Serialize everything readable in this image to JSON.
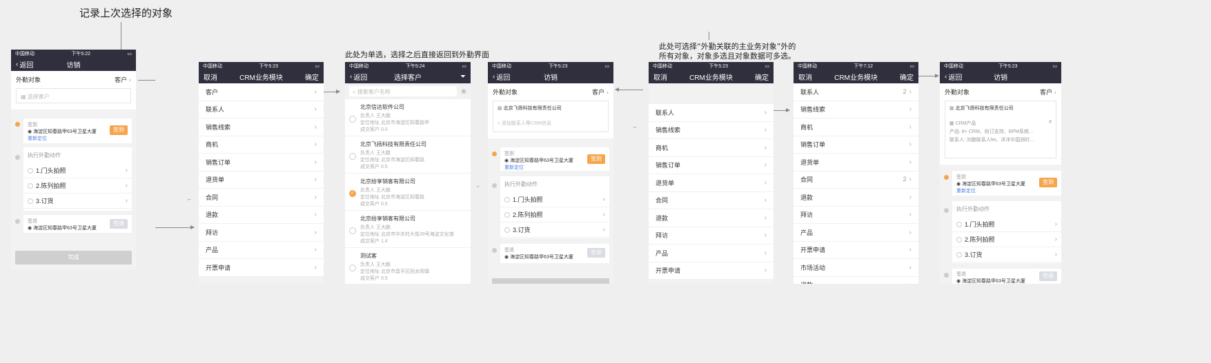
{
  "annotations": {
    "top_note": "记录上次选择的对象",
    "single_select": "此处为单选，选择之后直接返回到外勤界面",
    "multi_note_line1": "此处可选择“外勤关联的主业务对象”外的",
    "multi_note_line2": "所有对象，对象多选且对象数据可多选。"
  },
  "status": {
    "s1": {
      "carrier": "中国移动",
      "time": "下午5:22"
    },
    "s2": {
      "carrier": "中国移动",
      "time": "下午5:23"
    },
    "s3": {
      "carrier": "中国移动",
      "time": "下午5:24"
    },
    "s4": {
      "carrier": "中国移动",
      "time": "下午5:23"
    },
    "s5": {
      "carrier": "中国移动",
      "time": "下午5:23"
    },
    "s6": {
      "carrier": "中国移动",
      "time": "下午7:12"
    },
    "s7": {
      "carrier": "中国移动",
      "time": "下午5:23"
    }
  },
  "visit": {
    "back": "返回",
    "title": "访销",
    "field_label": "外勤对象",
    "field_type": "客户",
    "placeholder": "选择客户",
    "checkin_label": "签到",
    "checkin_address": "海淀区知春路甲63号卫星大厦",
    "relocate": "重新定位",
    "checkin_btn": "签到",
    "actions_title": "执行外勤动作",
    "actions": [
      "1.门头拍照",
      "2.陈列拍照",
      "3.订货"
    ],
    "checkout_label": "签退",
    "checkout_address": "海淀区知春路甲63号卫星大厦",
    "checkout_btn": "签退",
    "complete_btn": "完成",
    "selected_company": "北京飞扬科技有限责任公司",
    "add_link": "添加联系人等CRM信息",
    "checkin_address_alt": "海淀区知春路甲63号卫星大厦",
    "crm_label": "CRM产品",
    "crm_product_label": "产品:",
    "crm_product_value": "8+ CRM、纷订支持、BPM系统…",
    "crm_contact_label": "联系人:",
    "crm_contact_value": "刘鹏联系人fei、洋洋中国测时…"
  },
  "crm_module": {
    "cancel": "取消",
    "title": "CRM业务模块",
    "confirm": "确定",
    "items": [
      "客户",
      "联系人",
      "销售线索",
      "商机",
      "销售订单",
      "退货单",
      "合同",
      "退款",
      "拜访",
      "产品",
      "开票申请"
    ]
  },
  "crm_module_b": {
    "items": [
      "联系人",
      "销售线索",
      "商机",
      "销售订单",
      "退货单",
      "合同",
      "退款",
      "拜访",
      "产品",
      "开票申请"
    ]
  },
  "crm_module_c": {
    "items": [
      "联系人",
      "销售线索",
      "商机",
      "销售订单",
      "退货单",
      "合同",
      "退款",
      "拜访",
      "产品",
      "开票申请",
      "市场活动",
      "退款"
    ],
    "badge_contact": "2",
    "badge_contract": "2"
  },
  "customer_select": {
    "back": "返回",
    "title": "选择客户",
    "search_placeholder": "搜索客户名称",
    "customers": [
      {
        "name": "北京信达软件公司",
        "owner": "负责人 王大鹏",
        "addr": "定位地址 北京市海淀区知春路甲",
        "deal": "成交客户 0.0"
      },
      {
        "name": "北京飞扬科技有限责任公司",
        "owner": "负责人 王大鹏",
        "addr": "定位地址 北京市海淀区知春路",
        "deal": "成交客户 0.5"
      },
      {
        "name": "北京纷享销客有限公司",
        "owner": "负责人 王大鹏",
        "addr": "定位地址 北京市海淀区知春路",
        "deal": "成交客户 0.5"
      },
      {
        "name": "北京纷享销客有限公司",
        "owner": "负责人 王大鹏",
        "addr": "定位地址 北京市中关村大街28号海淀文化馆",
        "deal": "成交客户 1.4"
      },
      {
        "name": "测试客",
        "owner": "负责人 王大鹏",
        "addr": "定位地址 北京市昌平区回龙观镇",
        "deal": "成交客户 0.5"
      }
    ]
  },
  "colors": {
    "nav": "#2f2f3e",
    "accent": "#f6a54c",
    "bg": "#efefef"
  }
}
